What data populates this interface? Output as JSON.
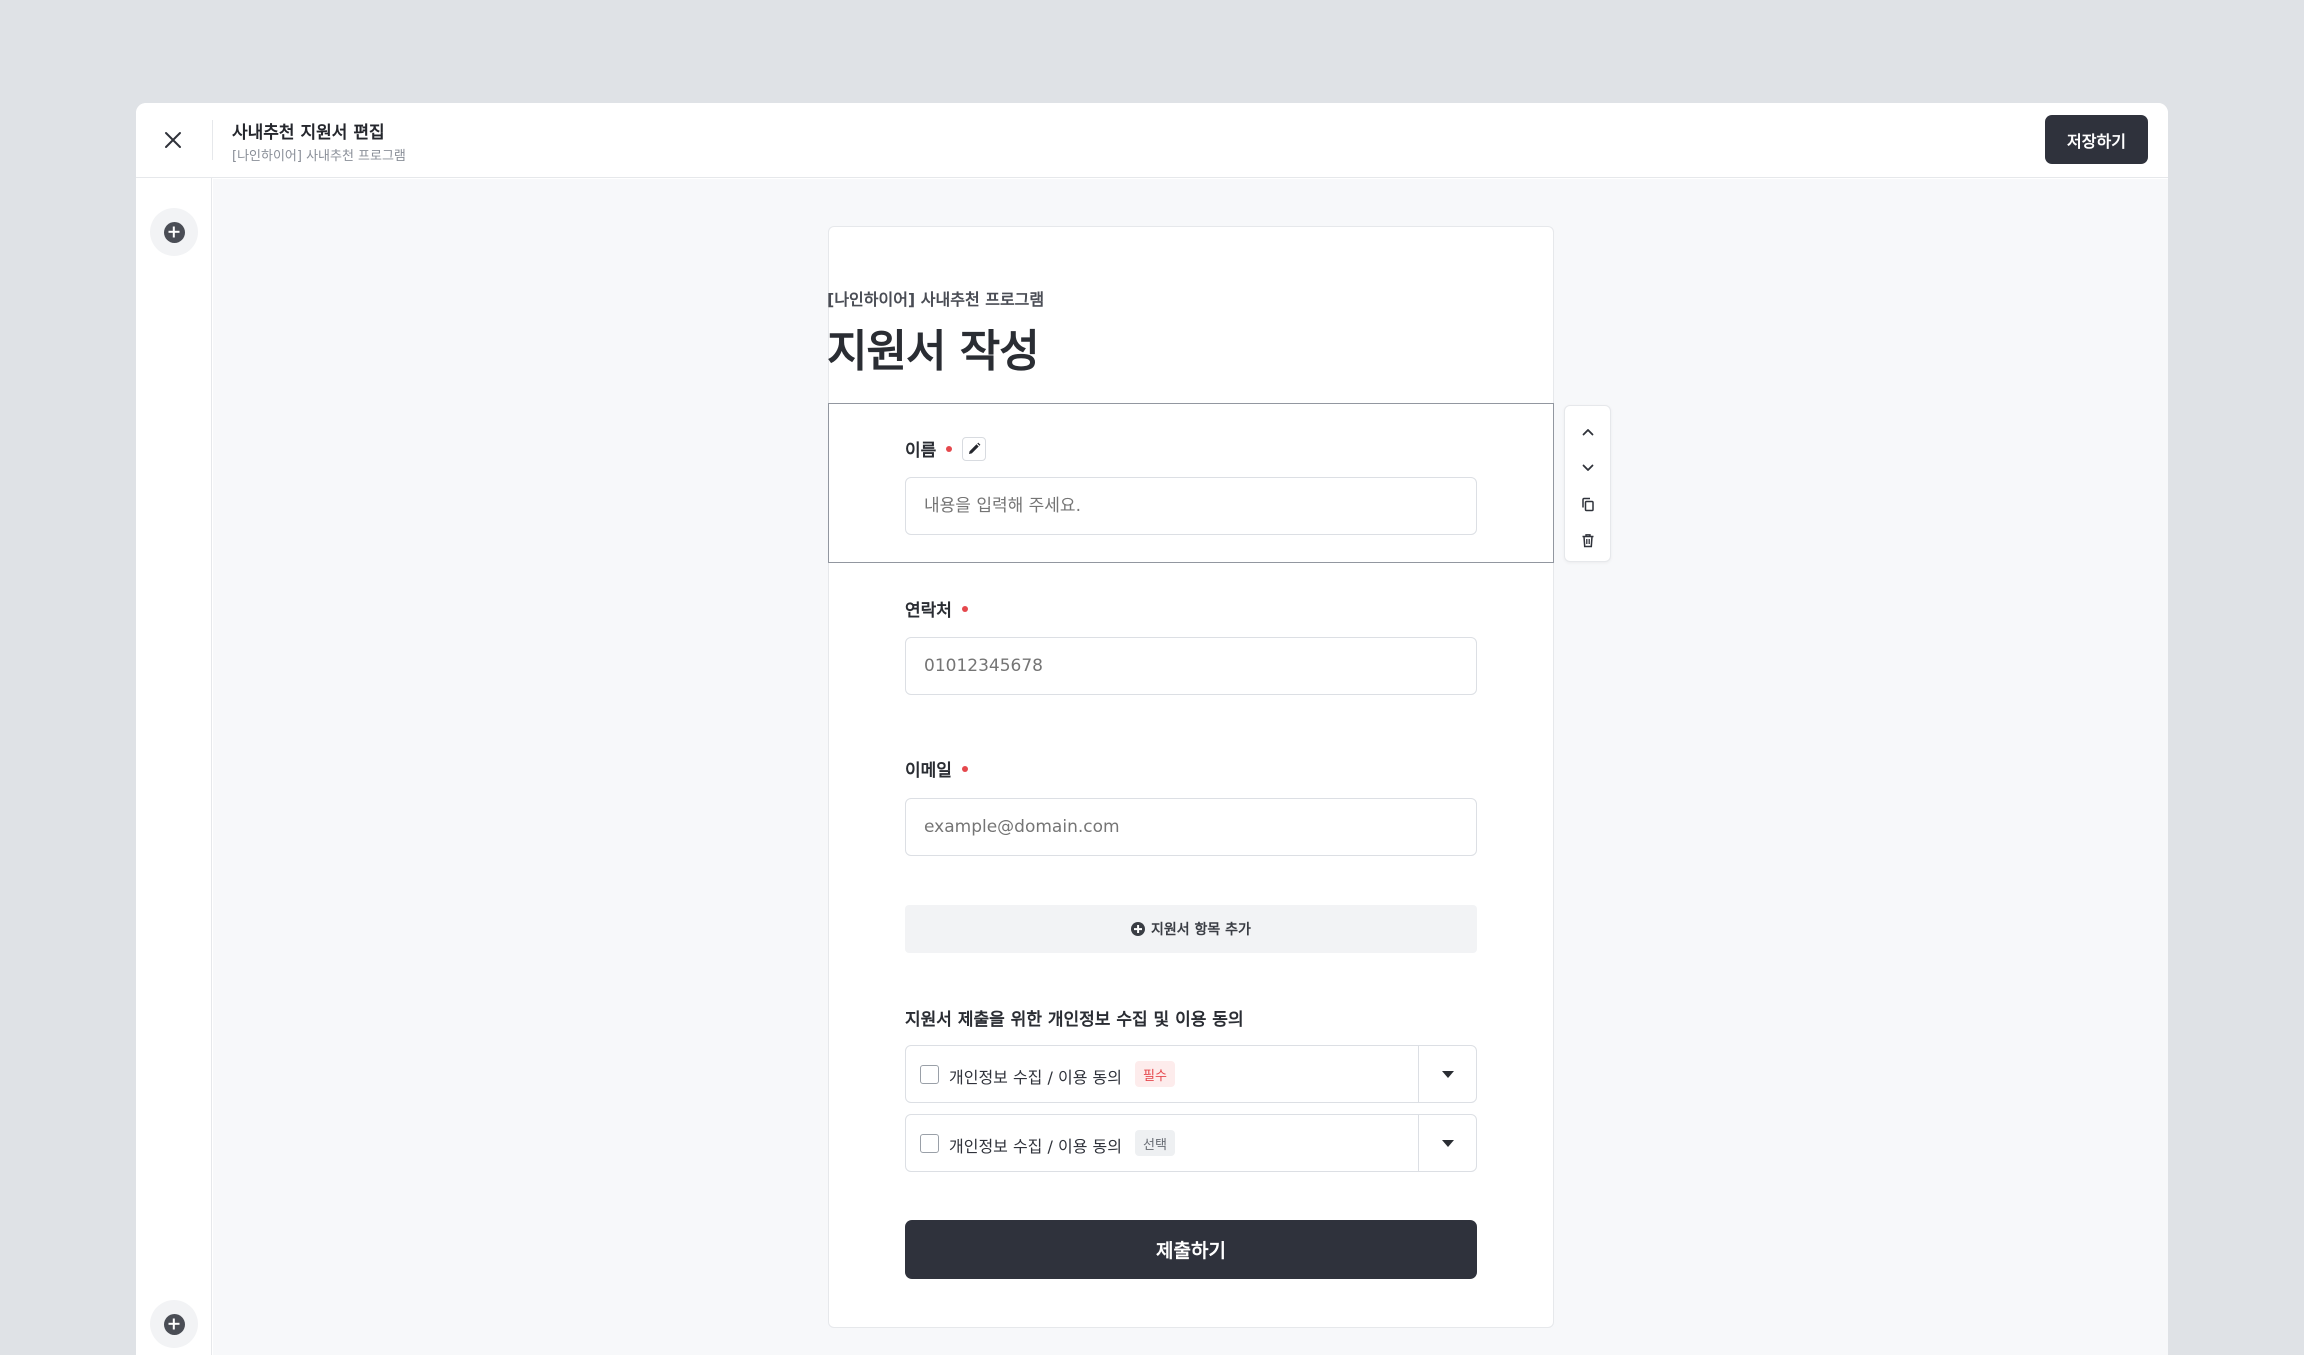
{
  "header": {
    "title": "사내추천 지원서 편집",
    "subtitle": "[나인하이어] 사내추천 프로그램",
    "save_label": "저장하기"
  },
  "form": {
    "overline": "[나인하이어] 사내추천 프로그램",
    "title": "지원서 작성",
    "fields": [
      {
        "label": "이름",
        "placeholder": "내용을 입력해 주세요.",
        "required": true
      },
      {
        "label": "연락처",
        "placeholder": "01012345678",
        "required": true
      },
      {
        "label": "이메일",
        "placeholder": "example@domain.com",
        "required": true
      }
    ],
    "add_field_label": "지원서 항목 추가",
    "consent": {
      "title": "지원서 제출을 위한 개인정보 수집 및 이용 동의",
      "items": [
        {
          "label": "개인정보 수집 / 이용 동의",
          "badge": "필수"
        },
        {
          "label": "개인정보 수집 / 이용 동의",
          "badge": "선택"
        }
      ]
    },
    "submit_label": "제출하기"
  },
  "toolbar": {
    "icons": [
      "chevron-up-icon",
      "chevron-down-icon",
      "copy-icon",
      "trash-icon"
    ]
  },
  "colors": {
    "primary": "#2f323c",
    "required": "#e5484d",
    "background": "#dfe2e6",
    "canvas": "#f7f8fa"
  }
}
